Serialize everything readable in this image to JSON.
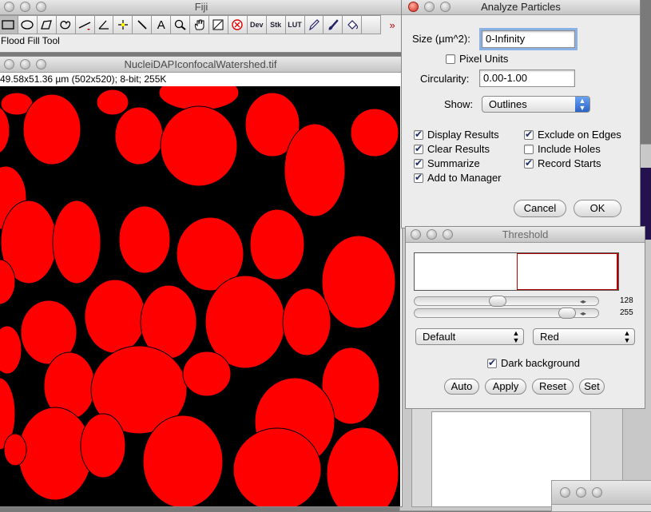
{
  "fiji": {
    "title": "Fiji",
    "status": "Flood Fill Tool",
    "tools": [
      {
        "name": "rectangle-tool",
        "kind": "rect"
      },
      {
        "name": "oval-tool",
        "kind": "oval"
      },
      {
        "name": "polygon-tool",
        "kind": "poly"
      },
      {
        "name": "freehand-tool",
        "kind": "free"
      },
      {
        "name": "line-tool",
        "kind": "line"
      },
      {
        "name": "angle-tool",
        "kind": "angle"
      },
      {
        "name": "point-tool",
        "kind": "point"
      },
      {
        "name": "wand-tool",
        "kind": "wand"
      },
      {
        "name": "text-tool",
        "kind": "text",
        "label": "A"
      },
      {
        "name": "magnifier-tool",
        "kind": "zoom"
      },
      {
        "name": "hand-tool",
        "kind": "hand"
      },
      {
        "name": "color-picker-tool",
        "kind": "picker"
      },
      {
        "name": "stop-tool",
        "kind": "stop"
      },
      {
        "name": "dev-tool",
        "kind": "label",
        "label": "Dev"
      },
      {
        "name": "stacks-tool",
        "kind": "label",
        "label": "Stk"
      },
      {
        "name": "lut-tool",
        "kind": "label",
        "label": "LUT"
      },
      {
        "name": "pencil-tool",
        "kind": "pencil"
      },
      {
        "name": "brush-tool",
        "kind": "brush"
      },
      {
        "name": "flood-fill-tool",
        "kind": "fill"
      },
      {
        "name": "empty-tool",
        "kind": "empty"
      },
      {
        "name": "more-tools",
        "kind": "more",
        "label": "»"
      }
    ]
  },
  "image": {
    "title": "NucleiDAPIconfocalWatershed.tif",
    "info": "49.58x51.36 µm (502x520); 8-bit; 255K"
  },
  "analyze": {
    "title": "Analyze Particles",
    "size_label": "Size (µm^2):",
    "size_value": "0-Infinity",
    "pixel_units": "Pixel Units",
    "circularity_label": "Circularity:",
    "circularity_value": "0.00-1.00",
    "show_label": "Show:",
    "show_value": "Outlines",
    "checks": {
      "display_results": "Display Results",
      "clear_results": "Clear Results",
      "summarize": "Summarize",
      "add_to_manager": "Add to Manager",
      "exclude_edges": "Exclude on Edges",
      "include_holes": "Include Holes",
      "record_starts": "Record Starts"
    },
    "cancel": "Cancel",
    "ok": "OK"
  },
  "threshold": {
    "title": "Threshold",
    "slider_min": "128",
    "slider_max": "255",
    "method": "Default",
    "mode": "Red",
    "dark_background": "Dark background",
    "buttons": {
      "auto": "Auto",
      "apply": "Apply",
      "reset": "Reset",
      "set": "Set"
    }
  },
  "colors": {
    "nuclei": "#ff0000",
    "background": "#000000",
    "histogram_line": "#b00000"
  }
}
